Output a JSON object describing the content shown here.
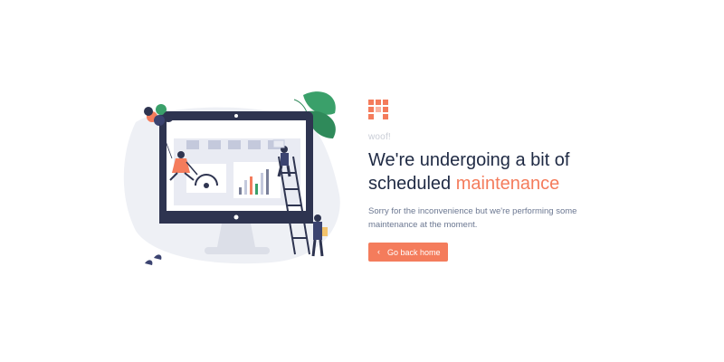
{
  "page": {
    "eyebrow": "woof!",
    "heading_line1": "We're undergoing a bit of",
    "heading_line2_prefix": "scheduled ",
    "heading_line2_accent": "maintenance",
    "description": "Sorry for the inconvenience but we're performing some maintenance at the moment.",
    "button_label": "Go back home"
  },
  "colors": {
    "accent": "#f47c5c",
    "heading": "#1f2a44",
    "muted": "#c9cdd6",
    "body": "#6b7791"
  },
  "icons": {
    "logo": "brand-logo-icon",
    "button": "chevron-left-icon"
  }
}
